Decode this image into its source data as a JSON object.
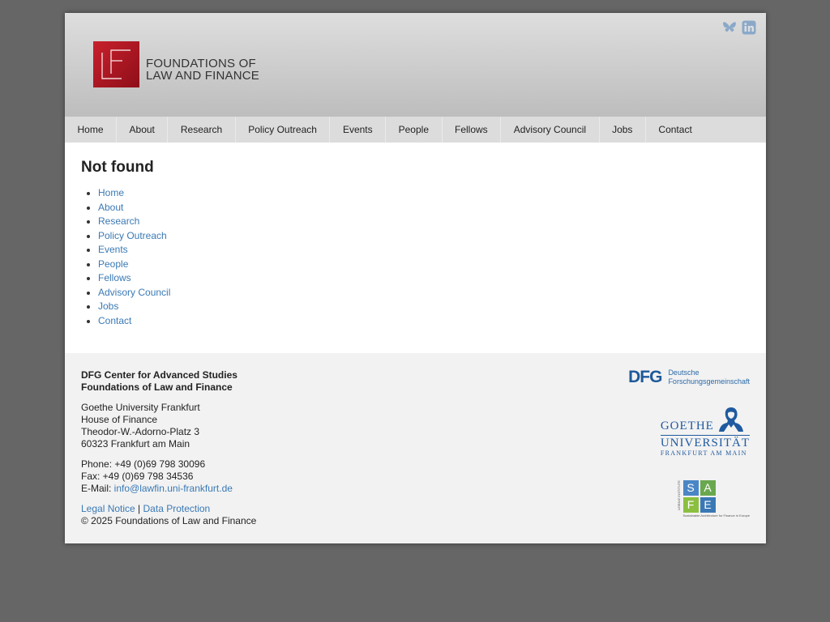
{
  "header": {
    "logo_line1": "FOUNDATIONS OF",
    "logo_line2": "LAW AND FINANCE",
    "social": [
      {
        "icon": "bluesky-icon",
        "color": "#8aa9c9"
      },
      {
        "icon": "linkedin-icon",
        "color": "#8aa9c9"
      }
    ]
  },
  "nav": {
    "items": [
      "Home",
      "About",
      "Research",
      "Policy Outreach",
      "Events",
      "People",
      "Fellows",
      "Advisory Council",
      "Jobs",
      "Contact"
    ]
  },
  "main": {
    "title": "Not found",
    "links": [
      "Home",
      "About",
      "Research",
      "Policy Outreach",
      "Events",
      "People",
      "Fellows",
      "Advisory Council",
      "Jobs",
      "Contact"
    ]
  },
  "footer": {
    "center_line1": "DFG Center for Advanced Studies",
    "center_line2": "Foundations of Law and Finance",
    "address": [
      "Goethe University Frankfurt",
      "House of Finance",
      "Theodor-W.-Adorno-Platz 3",
      "60323 Frankfurt am Main"
    ],
    "phone": "Phone: +49 (0)69 798 30096",
    "fax": "Fax: +49 (0)69 798 34536",
    "email_label": "E-Mail: ",
    "email": "info@lawfin.uni-frankfurt.de",
    "legal_notice": "Legal Notice",
    "separator": " | ",
    "data_protection": "Data Protection",
    "copyright": "© 2025 Foundations of Law and Finance",
    "dfg_mark": "DFG",
    "dfg_line1": "Deutsche",
    "dfg_line2": "Forschungsgemeinschaft",
    "goethe_line1": "GOETHE",
    "goethe_line2": "UNIVERSITÄT",
    "goethe_line3": "FRANKFURT AM MAIN",
    "safe_letters": [
      "S",
      "A",
      "F",
      "E"
    ],
    "safe_side": "LEIBNIZ INSTITUTE",
    "safe_caption": "Sustainable Architecture for Finance in Europe"
  },
  "colors": {
    "link": "#3a79b4",
    "logo_red": "#c8202c",
    "safe": [
      "#4a86c5",
      "#6aa84f",
      "#8bbf3f",
      "#3a78b5"
    ]
  }
}
